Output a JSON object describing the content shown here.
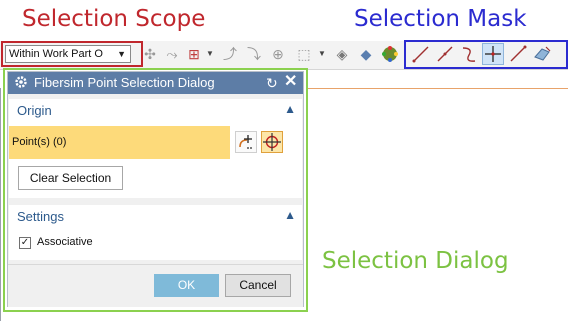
{
  "annotations": {
    "selection_scope": "Selection Scope",
    "selection_mask": "Selection Mask",
    "selection_dialog": "Selection Dialog"
  },
  "toolbar": {
    "scope_value": "Within Work Part O",
    "mask_icons": [
      "line-icon",
      "arc-icon",
      "spline-icon",
      "point-icon",
      "curve-icon",
      "face-icon"
    ],
    "active_mask": "point-icon"
  },
  "dialog": {
    "title": "Fibersim Point Selection Dialog",
    "origin": {
      "header": "Origin",
      "points_label": "Point(s) (0)",
      "clear_button": "Clear Selection"
    },
    "settings": {
      "header": "Settings",
      "associative_label": "Associative",
      "associative_checked": true
    },
    "ok_label": "OK",
    "cancel_label": "Cancel"
  },
  "colors": {
    "scope_frame": "#c0272d",
    "mask_frame": "#2b2bd0",
    "dialog_frame": "#8bd14f",
    "titlebar": "#5d7da6",
    "points_highlight": "#fdda7a",
    "ok_button": "#7fbad9"
  }
}
